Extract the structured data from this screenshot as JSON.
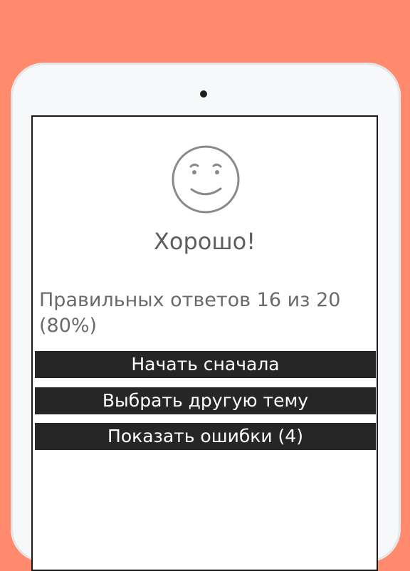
{
  "result": {
    "title": "Хорошо!",
    "score_text": "Правильных ответов 16 из 20 (80%)",
    "correct": 16,
    "total": 20,
    "percent": 80,
    "mood_icon": "smiley-face-icon"
  },
  "actions": {
    "restart_label": "Начать сначала",
    "choose_topic_label": "Выбрать другую тему",
    "show_errors_label": "Показать ошибки (4)"
  },
  "colors": {
    "background": "#FF8A6E",
    "button": "#262626",
    "button_text": "#FFFFFF",
    "text": "#6A6A6A"
  }
}
